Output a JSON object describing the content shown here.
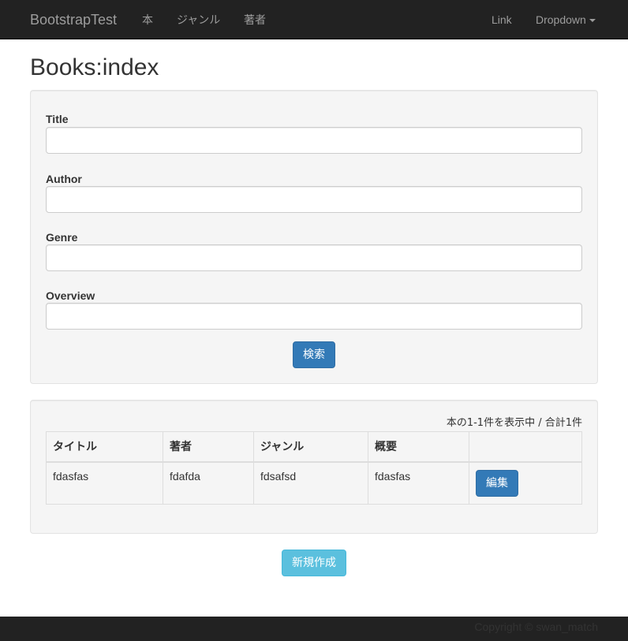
{
  "navbar": {
    "brand": "BootstrapTest",
    "left_links": [
      "本",
      "ジャンル",
      "著者"
    ],
    "right_links": {
      "link": "Link",
      "dropdown": "Dropdown"
    }
  },
  "page": {
    "title": "Books:index"
  },
  "search_form": {
    "fields": [
      {
        "label": "Title",
        "value": ""
      },
      {
        "label": "Author",
        "value": ""
      },
      {
        "label": "Genre",
        "value": ""
      },
      {
        "label": "Overview",
        "value": ""
      }
    ],
    "submit_label": "検索"
  },
  "results": {
    "summary": "本の1-1件を表示中 / 合計1件",
    "columns": [
      "タイトル",
      "著者",
      "ジャンル",
      "概要",
      ""
    ],
    "rows": [
      {
        "title": "fdasfas",
        "author": "fdafda",
        "genre": "fdsafsd",
        "overview": "fdasfas",
        "action_label": "編集"
      }
    ]
  },
  "new_button_label": "新規作成",
  "footer": {
    "copyright": "Copyright © swan_match"
  },
  "colors": {
    "navbar_bg": "#222222",
    "primary": "#337ab7",
    "info": "#5bc0de",
    "well_bg": "#f5f5f5"
  }
}
